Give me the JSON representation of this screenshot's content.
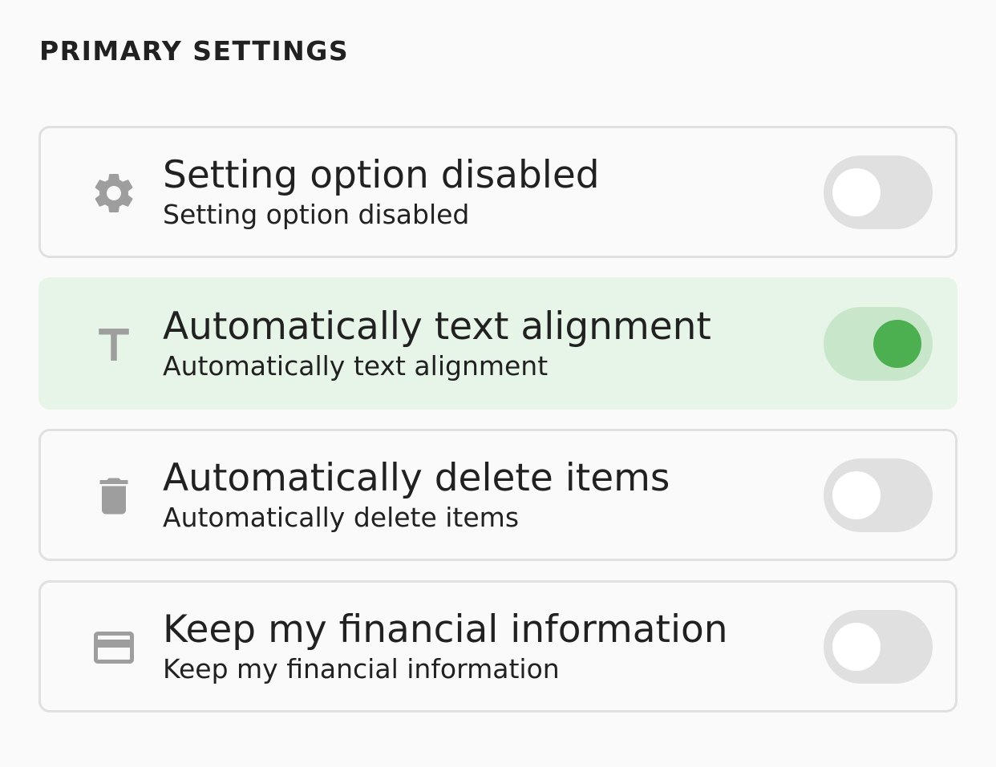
{
  "section": {
    "title": "PRIMARY SETTINGS"
  },
  "settings": [
    {
      "icon": "gear-icon",
      "title": "Setting option disabled",
      "subtitle": "Setting option disabled",
      "enabled": false
    },
    {
      "icon": "text-format-icon",
      "title": "Automatically text alignment",
      "subtitle": "Automatically text alignment",
      "enabled": true
    },
    {
      "icon": "trash-icon",
      "title": "Automatically delete items",
      "subtitle": "Automatically delete items",
      "enabled": false
    },
    {
      "icon": "credit-card-icon",
      "title": "Keep my financial information",
      "subtitle": "Keep my financial information",
      "enabled": false
    }
  ],
  "colors": {
    "background": "#fafafa",
    "card_border": "#e0e0e0",
    "active_card_bg": "#e7f5e8",
    "toggle_off_track": "#e0e0e0",
    "toggle_on_track": "#c8e6c9",
    "toggle_on_knob": "#4caf50",
    "icon": "#9e9e9e"
  }
}
